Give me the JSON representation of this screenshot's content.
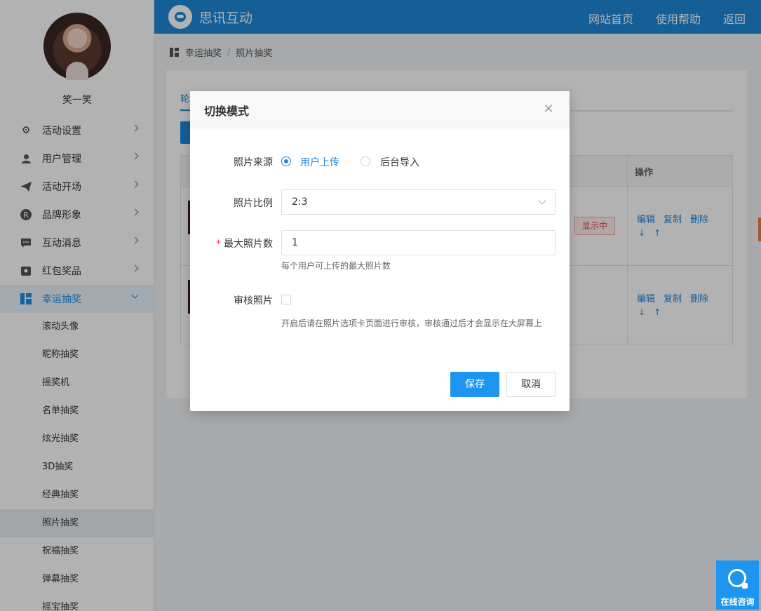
{
  "header": {
    "brand": "思讯互动",
    "links": [
      "网站首页",
      "使用帮助",
      "返回"
    ]
  },
  "sidebar": {
    "username": "笑一笑",
    "menu": [
      {
        "label": "活动设置",
        "icon": "gear-icon"
      },
      {
        "label": "用户管理",
        "icon": "user-icon"
      },
      {
        "label": "活动开场",
        "icon": "paper-plane-icon"
      },
      {
        "label": "品牌形象",
        "icon": "registered-icon"
      },
      {
        "label": "互动消息",
        "icon": "chat-icon"
      },
      {
        "label": "红包奖品",
        "icon": "gift-icon"
      },
      {
        "label": "幸运抽奖",
        "icon": "lottery-icon"
      }
    ],
    "submenu": [
      "滚动头像",
      "昵称抽奖",
      "摇奖机",
      "名单抽奖",
      "炫光抽奖",
      "3D抽奖",
      "经典抽奖",
      "照片抽奖",
      "祝福抽奖",
      "弹幕抽奖",
      "摇宝抽奖"
    ]
  },
  "breadcrumb": {
    "parent": "幸运抽奖",
    "separator": "/",
    "current": "照片抽奖"
  },
  "content": {
    "tab_label": "轮",
    "table_header_op": "操作",
    "status_badge": "显示中",
    "row_ops": {
      "edit": "编辑",
      "copy": "复制",
      "delete": "删除",
      "down": "↓",
      "up": "↑"
    }
  },
  "modal": {
    "title": "切换模式",
    "close": "×",
    "source_label": "照片来源",
    "source_options": {
      "user_upload": "用户上传",
      "backend_import": "后台导入"
    },
    "source_selected": "用户上传",
    "ratio_label": "照片比例",
    "ratio_value": "2:3",
    "max_label": "最大照片数",
    "max_required_mark": "*",
    "max_value": "1",
    "max_hint": "每个用户可上传的最大照片数",
    "review_label": "审核照片",
    "review_checked": false,
    "review_hint": "开启后请在照片选项卡页面进行审核，审核通过后才会显示在大屏幕上",
    "save": "保存",
    "cancel": "取消"
  },
  "consult": {
    "label": "在线咨询"
  },
  "colors": {
    "primary": "#1e88d8",
    "danger": "#e04444"
  }
}
